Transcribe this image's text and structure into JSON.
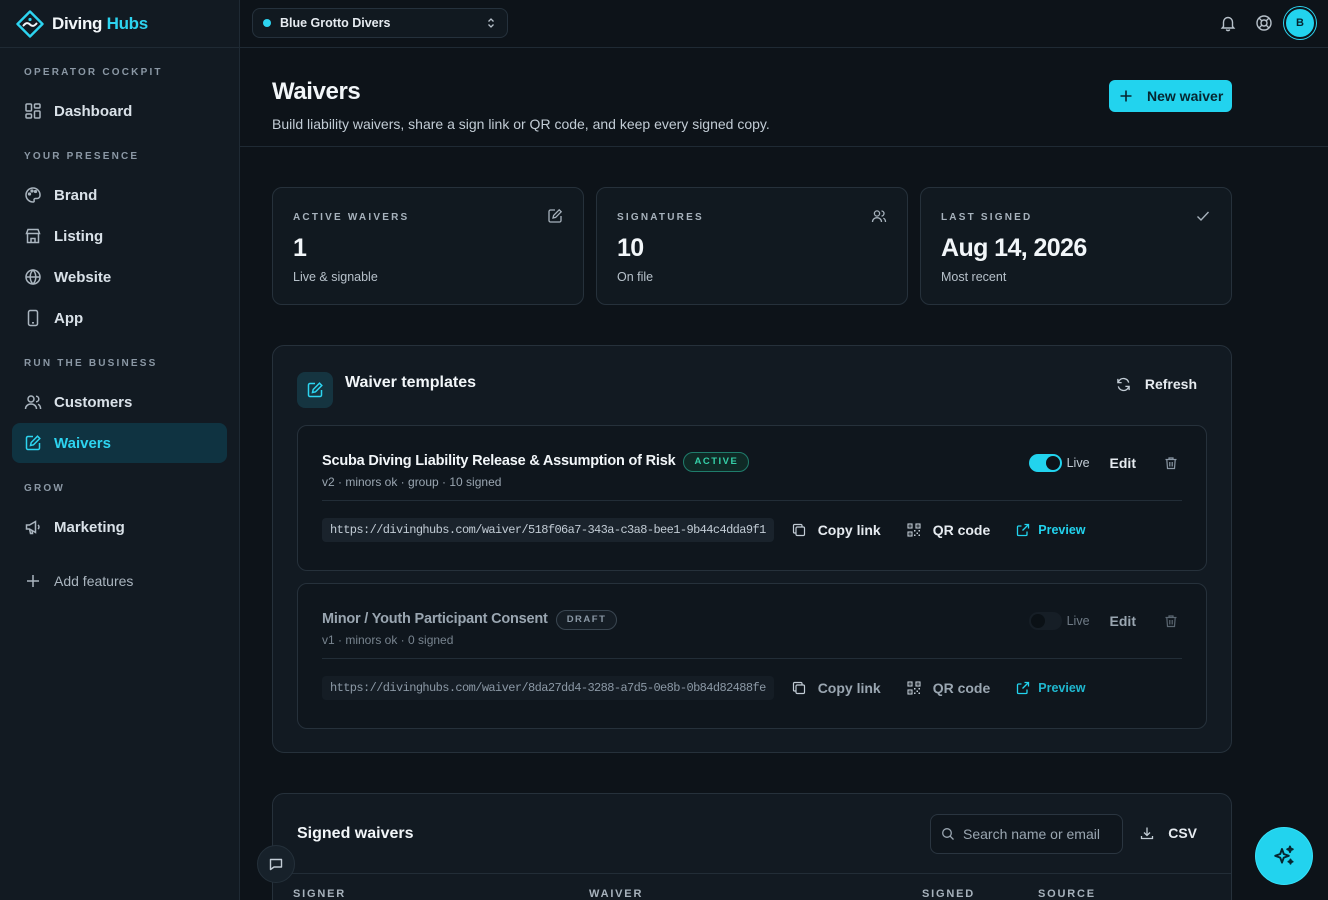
{
  "brand": {
    "name_prefix": "Diving",
    "name_suffix": "Hubs",
    "logo_icon": "diamond-wave-logo"
  },
  "org_select": {
    "value": "Blue Grotto Divers"
  },
  "topbar": {
    "avatar_initial": "B",
    "icons": [
      "bell-icon",
      "help-icon"
    ]
  },
  "sidebar": {
    "sections": [
      {
        "label": "OPERATOR COCKPIT"
      },
      {
        "label": "YOUR PRESENCE"
      },
      {
        "label": "RUN THE BUSINESS"
      },
      {
        "label": "GROW"
      }
    ],
    "items": [
      {
        "label": "Dashboard",
        "icon": "dashboard-icon"
      },
      {
        "label": "Brand",
        "icon": "palette-icon"
      },
      {
        "label": "Listing",
        "icon": "store-icon"
      },
      {
        "label": "Website",
        "icon": "globe-icon"
      },
      {
        "label": "App",
        "icon": "phone-icon"
      },
      {
        "label": "Customers",
        "icon": "users-icon"
      },
      {
        "label": "Waivers",
        "icon": "waiver-icon",
        "active": true
      },
      {
        "label": "Marketing",
        "icon": "megaphone-icon"
      },
      {
        "label": "Add features",
        "icon": "plus-icon"
      }
    ]
  },
  "header": {
    "title": "Waivers",
    "subtitle": "Build liability waivers, share a sign link or QR code, and keep every signed copy.",
    "new_button": "New waiver"
  },
  "stats": [
    {
      "label": "ACTIVE WAIVERS",
      "value": "1",
      "sub": "Live & signable",
      "icon": "edit-square-icon"
    },
    {
      "label": "SIGNATURES",
      "value": "10",
      "sub": "On file",
      "icon": "users-icon"
    },
    {
      "label": "LAST SIGNED",
      "value": "Aug 14, 2026",
      "sub": "Most recent",
      "icon": "check-icon"
    }
  ],
  "templates": {
    "title": "Waiver templates",
    "refresh_label": "Refresh",
    "items": [
      {
        "name": "Scuba Diving Liability Release & Assumption of Risk",
        "badge": "ACTIVE",
        "meta": "v2 · minors ok · group · 10 signed",
        "live": true,
        "live_label": "Live",
        "edit_label": "Edit",
        "url": "https://divinghubs.com/waiver/518f06a7-343a-c3a8-bee1-9b44c4dda9f1",
        "copy_label": "Copy link",
        "qr_label": "QR code",
        "preview_label": "Preview"
      },
      {
        "name": "Minor / Youth Participant Consent",
        "badge": "DRAFT",
        "meta": "v1 · minors ok · 0 signed",
        "live": false,
        "live_label": "Live",
        "edit_label": "Edit",
        "url": "https://divinghubs.com/waiver/8da27dd4-3288-a7d5-0e8b-0b84d82488fe",
        "copy_label": "Copy link",
        "qr_label": "QR code",
        "preview_label": "Preview"
      }
    ]
  },
  "signed": {
    "title": "Signed waivers",
    "search_placeholder": "Search name or email",
    "csv_label": "CSV",
    "columns": [
      "SIGNER",
      "WAIVER",
      "SIGNED",
      "SOURCE"
    ]
  },
  "floating": {
    "assistant_icon": "sparkles-icon",
    "chat_icon": "chat-icon"
  },
  "colors": {
    "accent": "#22d3ee",
    "active_badge": "#35d0a8",
    "bg": "#0d1319",
    "sidebar_active": "#0f3341"
  }
}
